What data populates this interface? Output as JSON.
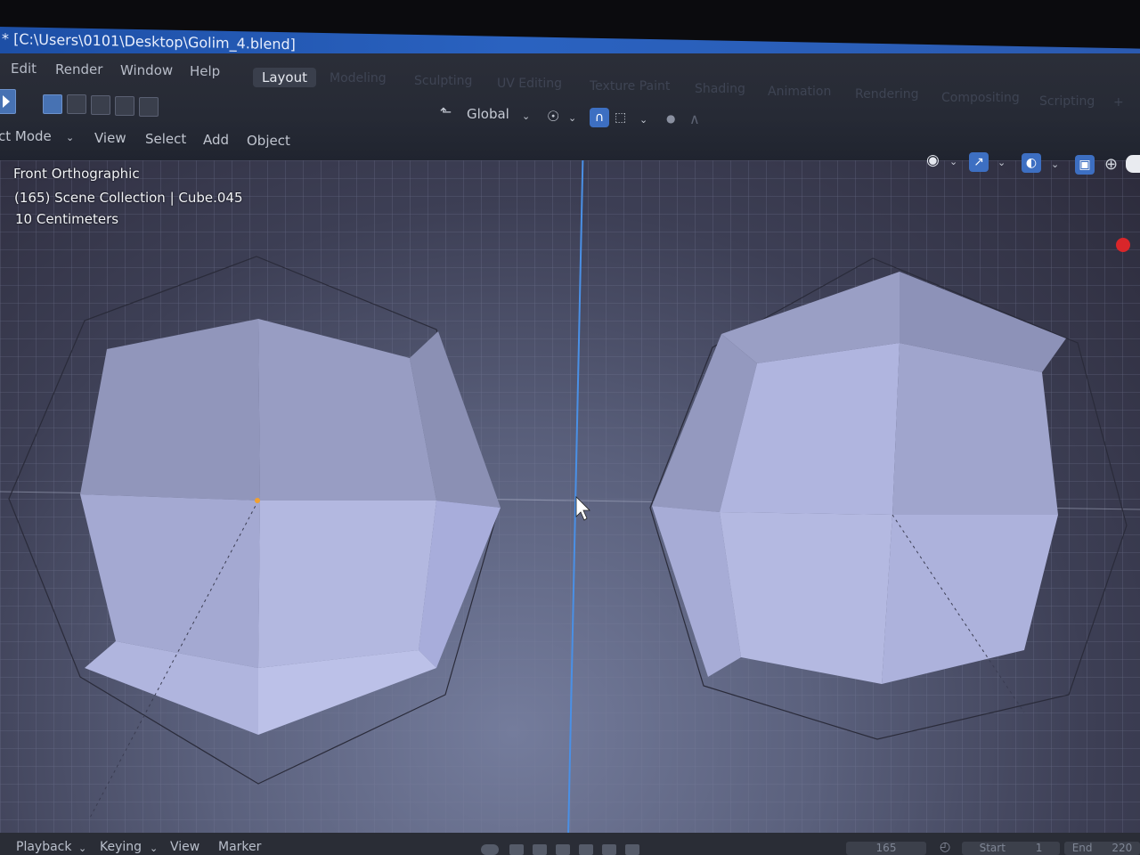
{
  "window": {
    "title": "* [C:\\Users\\0101\\Desktop\\Golim_4.blend]"
  },
  "menu": {
    "items": [
      "Edit",
      "Render",
      "Window",
      "Help"
    ]
  },
  "workspaces": {
    "active": "Layout",
    "tabs": [
      "Modeling",
      "Sculpting",
      "UV Editing",
      "Texture Paint",
      "Shading",
      "Animation",
      "Rendering",
      "Compositing",
      "Scripting",
      "+"
    ]
  },
  "toolbar": {
    "transform_orientation": "Global"
  },
  "header_menu": {
    "mode": "ct Mode",
    "items": [
      "View",
      "Select",
      "Add",
      "Object"
    ]
  },
  "viewport": {
    "view_name": "Front Orthographic",
    "collection_info": "(165) Scene Collection | Cube.045",
    "grid_scale": "10 Centimeters",
    "colors": {
      "mesh_face": "#a9afd6",
      "grid_line": "#7a809c",
      "center_line": "#4a90e6",
      "origin_dot": "#f0a030"
    }
  },
  "timeline": {
    "items": [
      "Playback",
      "Keying",
      "View",
      "Marker"
    ],
    "current_frame": "165",
    "start_label": "Start",
    "start_value": "1",
    "end_label": "End",
    "end_value": "220"
  },
  "icons": {
    "cursor": "mouse-pointer-icon",
    "select": "select-tool-icon",
    "snap": "magnet-icon",
    "proportional": "proportional-edit-icon",
    "visibility": "eye-visibility-icon",
    "gizmo": "gizmo-icon",
    "overlay": "overlay-icon",
    "xray": "xray-icon",
    "shading": "shading-solid-icon",
    "record": "record-icon"
  }
}
